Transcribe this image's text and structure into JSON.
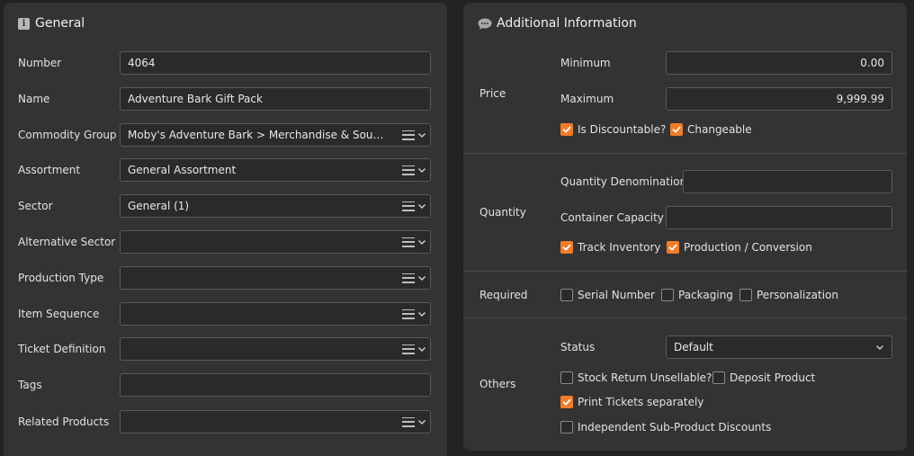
{
  "general": {
    "title": "General",
    "fields": [
      {
        "label": "Number",
        "value": "4064",
        "type": "text"
      },
      {
        "label": "Name",
        "value": "Adventure Bark Gift Pack",
        "type": "text"
      },
      {
        "label": "Commodity Group",
        "value": "Moby's Adventure Bark > Merchandise & Souvenirs ...",
        "type": "select"
      },
      {
        "label": "Assortment",
        "value": "General Assortment",
        "type": "select"
      },
      {
        "label": "Sector",
        "value": "General (1)",
        "type": "select"
      },
      {
        "label": "Alternative Sector",
        "value": "",
        "type": "select"
      },
      {
        "label": "Production Type",
        "value": "",
        "type": "select"
      },
      {
        "label": "Item Sequence",
        "value": "",
        "type": "select"
      },
      {
        "label": "Ticket Definition",
        "value": "",
        "type": "select"
      },
      {
        "label": "Tags",
        "value": "",
        "type": "text"
      },
      {
        "label": "Related Products",
        "value": "",
        "type": "select"
      }
    ]
  },
  "additional": {
    "title": "Additional Information",
    "price": {
      "label": "Price",
      "minimum_label": "Minimum",
      "minimum_value": "0.00",
      "maximum_label": "Maximum",
      "maximum_value": "9,999.99",
      "is_discountable_label": "Is Discountable?",
      "is_discountable": true,
      "changeable_label": "Changeable",
      "changeable": true
    },
    "quantity": {
      "label": "Quantity",
      "denomination_label": "Quantity Denomination",
      "denomination_value": "",
      "container_label": "Container Capacity",
      "container_value": "",
      "track_inventory_label": "Track Inventory",
      "track_inventory": true,
      "production_label": "Production / Conversion",
      "production": true
    },
    "required": {
      "label": "Required",
      "serial_label": "Serial Number",
      "serial": false,
      "packaging_label": "Packaging",
      "packaging": false,
      "personalization_label": "Personalization",
      "personalization": false
    },
    "others": {
      "label": "Others",
      "status_label": "Status",
      "status_value": "Default",
      "stock_return_label": "Stock Return Unsellable?",
      "stock_return": false,
      "deposit_label": "Deposit Product",
      "deposit": false,
      "print_tickets_label": "Print Tickets separately",
      "print_tickets": true,
      "independent_label": "Independent Sub-Product Discounts",
      "independent": false
    }
  },
  "colors": {
    "accent": "#f07c2a",
    "panel": "#333333",
    "background": "#232323"
  }
}
